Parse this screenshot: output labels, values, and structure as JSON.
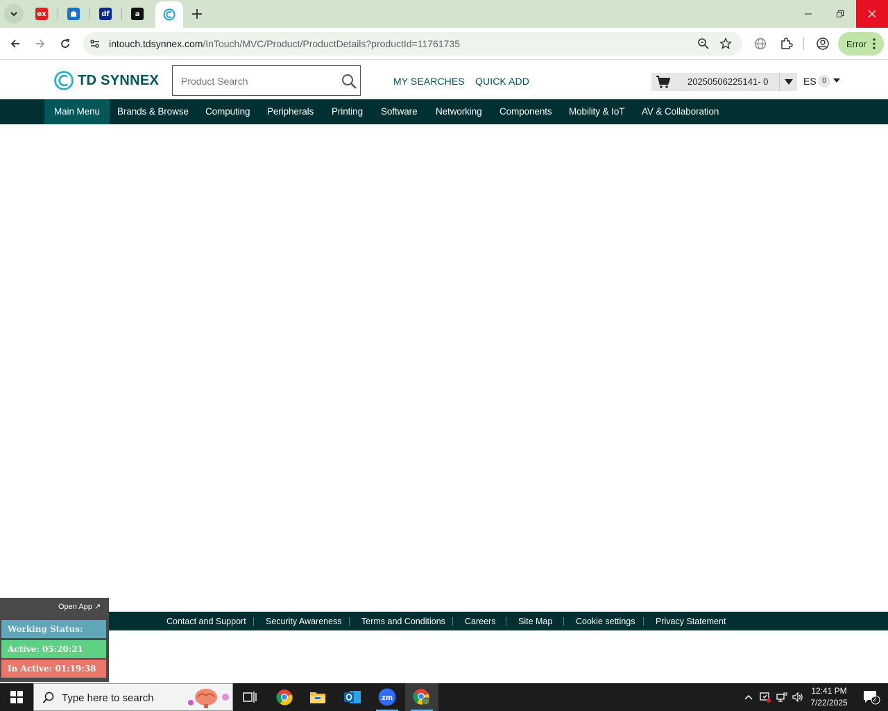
{
  "browser": {
    "tabs": [
      {
        "name": "ex-tab",
        "fav_text": "ex",
        "fav_color": "#e02020"
      },
      {
        "name": "blue-tab",
        "fav_text": "",
        "fav_color": "#1a73c8"
      },
      {
        "name": "df-tab",
        "fav_text": "df",
        "fav_color": "#0b2a8f"
      },
      {
        "name": "amazon-tab",
        "fav_text": "a",
        "fav_color": "#111111"
      },
      {
        "name": "tdsynnex-tab",
        "fav_text": "",
        "fav_color": "#1aa0d0",
        "active": true
      }
    ],
    "url_host": "intouch.tdsynnex.com",
    "url_path": "/InTouch/MVC/Product/ProductDetails?productId=11761735",
    "profile_status": "Error"
  },
  "site": {
    "logo_text": "TD SYNNEX",
    "search_placeholder": "Product Search",
    "my_searches": "MY SEARCHES",
    "quick_add": "QUICK ADD",
    "cart_label": "20250506225141- 0",
    "account_label": "ES",
    "account_count": "0",
    "brand_color": "#005758",
    "nav_color": "#003031"
  },
  "mainnav": {
    "items": [
      "Main Menu",
      "Brands & Browse",
      "Computing",
      "Peripherals",
      "Printing",
      "Software",
      "Networking",
      "Components",
      "Mobility & IoT",
      "AV & Collaboration"
    ],
    "active_index": 0
  },
  "footer": {
    "links": [
      "Contact and Support",
      "Security Awareness",
      "Terms and Conditions",
      "Careers",
      "Site Map",
      "Cookie settings",
      "Privacy Statement"
    ]
  },
  "work_status": {
    "open_app": "Open App ↗",
    "status": "Working Status: Active",
    "active": "Active: 05:20:21",
    "inactive": "In Active: 01:19:38"
  },
  "taskbar": {
    "search_placeholder": "Type here to search",
    "time": "12:41 PM",
    "date": "7/22/2025",
    "notification_count": "2"
  }
}
